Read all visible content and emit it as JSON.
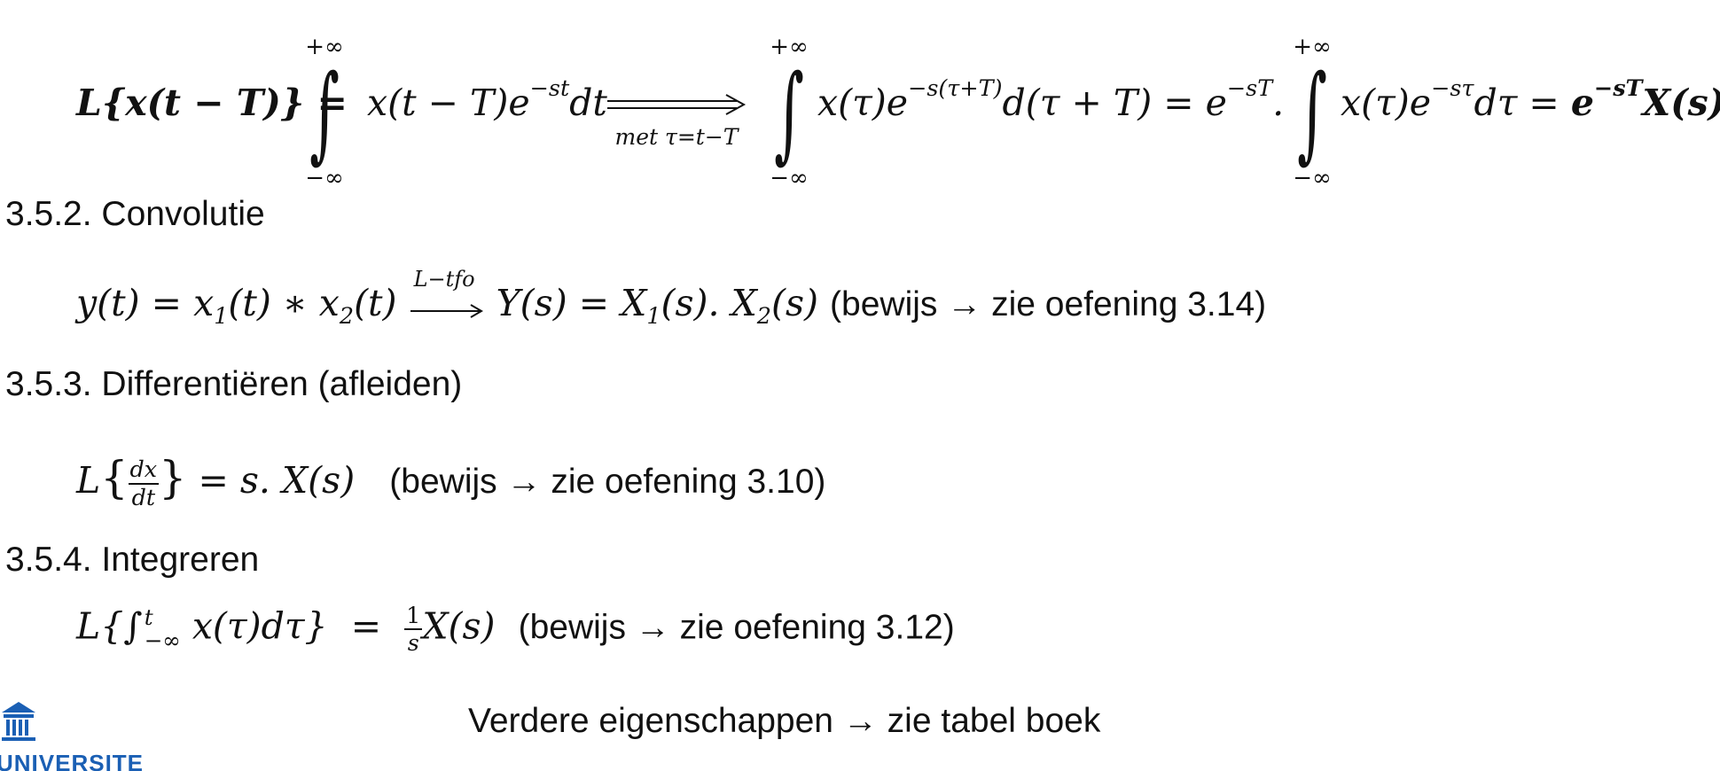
{
  "headings": {
    "convolution": "3.5.2. Convolutie",
    "differentiate": "3.5.3. Differentiëren (afleiden)",
    "integrate": "3.5.4. Integreren"
  },
  "notes": {
    "convolution": "(bewijs → zie oefening 3.14)",
    "differentiate": "(bewijs → zie oefening 3.10)",
    "integrate": "(bewijs → zie oefening 3.12)"
  },
  "footer_text": "Verdere eigenschappen → zie tabel boek",
  "shift_formula": {
    "substitution_label": "met τ=t−T",
    "upper_limit": "+∞",
    "lower_limit": "−∞"
  },
  "convolution_arrow_label": "L−tfo",
  "logo": {
    "icon": "university-building-icon",
    "text": "UNIVERSITEIT",
    "color": "#1a5fb4"
  }
}
